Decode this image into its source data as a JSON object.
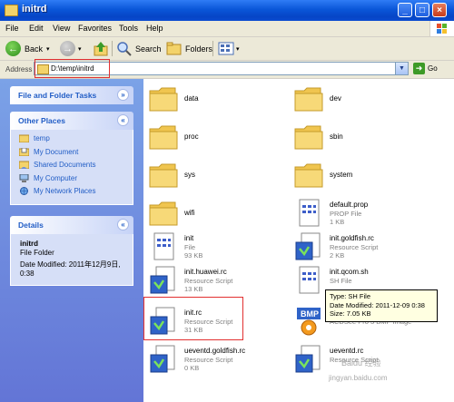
{
  "window": {
    "title": "initrd"
  },
  "menu": [
    "File",
    "Edit",
    "View",
    "Favorites",
    "Tools",
    "Help"
  ],
  "toolbar": {
    "back": "Back",
    "search": "Search",
    "folders": "Folders"
  },
  "address": {
    "label": "Address",
    "value": "D:\\temp\\initrd",
    "go": "Go"
  },
  "tasks": {
    "title": "File and Folder Tasks"
  },
  "other_places": {
    "title": "Other Places",
    "items": [
      "temp",
      "My Document",
      "Shared Documents",
      "My Computer",
      "My Network Places"
    ]
  },
  "details": {
    "title": "Details",
    "name": "initrd",
    "type": "File Folder",
    "modified": "Date Modified: 2011年12月9日, 0:38"
  },
  "files": [
    {
      "name": "data",
      "kind": "folder"
    },
    {
      "name": "dev",
      "kind": "folder"
    },
    {
      "name": "proc",
      "kind": "folder"
    },
    {
      "name": "sbin",
      "kind": "folder"
    },
    {
      "name": "sys",
      "kind": "folder"
    },
    {
      "name": "system",
      "kind": "folder"
    },
    {
      "name": "wifi",
      "kind": "folder"
    },
    {
      "name": "default.prop",
      "type": "PROP File",
      "size": "1 KB",
      "kind": "doc"
    },
    {
      "name": "init",
      "type": "File",
      "size": "93 KB",
      "kind": "doc"
    },
    {
      "name": "init.goldfish.rc",
      "type": "Resource Script",
      "size": "2 KB",
      "kind": "script"
    },
    {
      "name": "init.huawei.rc",
      "type": "Resource Script",
      "size": "13 KB",
      "kind": "script"
    },
    {
      "name": "init.qcom.sh",
      "type": "SH File",
      "size": "",
      "kind": "doc"
    },
    {
      "name": "init.rc",
      "type": "Resource Script",
      "size": "31 KB",
      "kind": "script"
    },
    {
      "name": "",
      "type": "ACDSee Pro 3 BMP Image",
      "size": "",
      "kind": "bmp"
    },
    {
      "name": "ueventd.goldfish.rc",
      "type": "Resource Script",
      "size": "0 KB",
      "kind": "script"
    },
    {
      "name": "ueventd.rc",
      "type": "Resource Script",
      "size": "",
      "kind": "script"
    }
  ],
  "tooltip": {
    "type": "Type: SH File",
    "modified": "Date Modified: 2011-12-09 0:38",
    "size": "Size: 7.05 KB"
  },
  "watermark": {
    "brand": "Baidu 经验",
    "url": "jingyan.baidu.com"
  }
}
